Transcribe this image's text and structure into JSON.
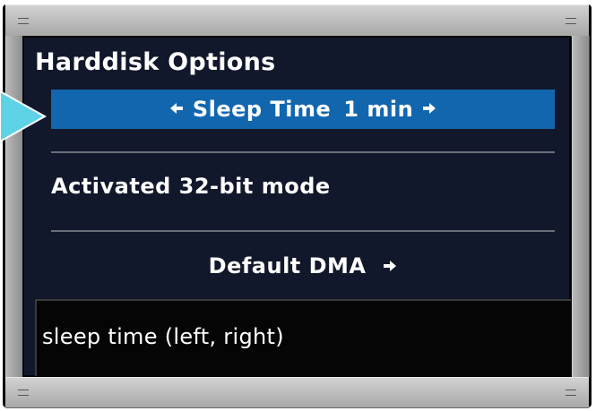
{
  "window": {
    "title": "Harddisk Options"
  },
  "menu": {
    "selected_item": {
      "label": "Sleep Time",
      "value": "1 min",
      "left_arrow": "🡐",
      "right_arrow": "🡒"
    },
    "items": [
      {
        "label": "Activated 32-bit mode"
      },
      {
        "label": "Default DMA",
        "right_arrow": "🡒"
      }
    ]
  },
  "help": {
    "text": "sleep time (left, right)"
  },
  "colors": {
    "panel_background": "#12182b",
    "selection_highlight": "#1266ae",
    "pointer": "#5fd3e6",
    "chrome": "#bcbcbc"
  },
  "icons": {
    "pointer": "pointer-triangle-icon",
    "left": "left-arrow-icon",
    "right": "right-arrow-icon"
  }
}
